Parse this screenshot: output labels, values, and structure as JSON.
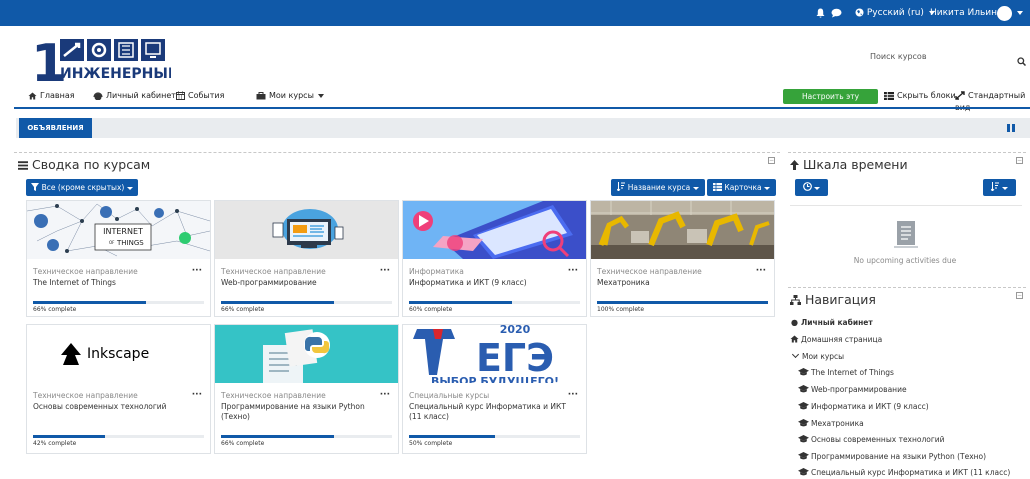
{
  "topbar": {
    "language": "Русский (ru)",
    "user_name": "Никита Ильин"
  },
  "logo": {
    "text": "ИНЖЕНЕРНЫЙ",
    "numeral": "1"
  },
  "search": {
    "placeholder": "Поиск курсов"
  },
  "nav": {
    "home": "Главная",
    "dashboard": "Личный кабинет",
    "events": "События",
    "my_courses": "Мои курсы",
    "customize": "Настроить эту страницу",
    "hide_blocks": "Скрыть блоки",
    "standard_view": "Стандартный вид"
  },
  "announcements": {
    "label": "ОБЪЯВЛЕНИЯ"
  },
  "overview": {
    "title": "Сводка по курсам",
    "filter_label": "Все (кроме скрытых)",
    "sort_label": "Название курса",
    "view_label": "Карточка",
    "courses": [
      {
        "category": "Техническое направление",
        "name": "The Internet of Things",
        "progress": 66,
        "progress_label": "66% complete",
        "image": "iot"
      },
      {
        "category": "Техническое направление",
        "name": "Web-программирование",
        "progress": 66,
        "progress_label": "66% complete",
        "image": "web"
      },
      {
        "category": "Информатика",
        "name": "Информатика и ИКТ (9 класс)",
        "progress": 60,
        "progress_label": "60% complete",
        "image": "it"
      },
      {
        "category": "Техническое направление",
        "name": "Мехатроника",
        "progress": 100,
        "progress_label": "100% complete",
        "image": "robots"
      },
      {
        "category": "Техническое направление",
        "name": "Основы современных технологий",
        "progress": 42,
        "progress_label": "42% complete",
        "image": "inkscape"
      },
      {
        "category": "Техническое направление",
        "name": "Программирование на языки Python (Техно)",
        "progress": 66,
        "progress_label": "66% complete",
        "image": "python"
      },
      {
        "category": "Специальные курсы",
        "name": "Специальный курс Информатика и ИКТ (11 класс)",
        "progress": 50,
        "progress_label": "50% complete",
        "image": "ege"
      }
    ],
    "image_texts": {
      "iot_top": "INTERNET",
      "iot_mid": "OF",
      "iot_bot": "THINGS",
      "inkscape": "Inkscape",
      "ege_year": "2020",
      "ege_main": "ЕГЭ",
      "ege_bottom": "ВЫБОР БУДУЩЕГО!"
    }
  },
  "timeline": {
    "title": "Шкала времени",
    "empty_text": "No upcoming activities due"
  },
  "navigation": {
    "title": "Навигация",
    "dashboard": "Личный кабинет",
    "home": "Домашняя страница",
    "my_courses": "Мои курсы",
    "courses": [
      "The Internet of Things",
      "Web-программирование",
      "Информатика и ИКТ (9 класс)",
      "Мехатроника",
      "Основы современных технологий",
      "Программирование на языки Python (Техно)",
      "Специальный курс Информатика и ИКТ (11 класс)"
    ]
  },
  "colors": {
    "brand": "#1059a8",
    "green": "#36a33a",
    "topbar": "#1059a8"
  }
}
